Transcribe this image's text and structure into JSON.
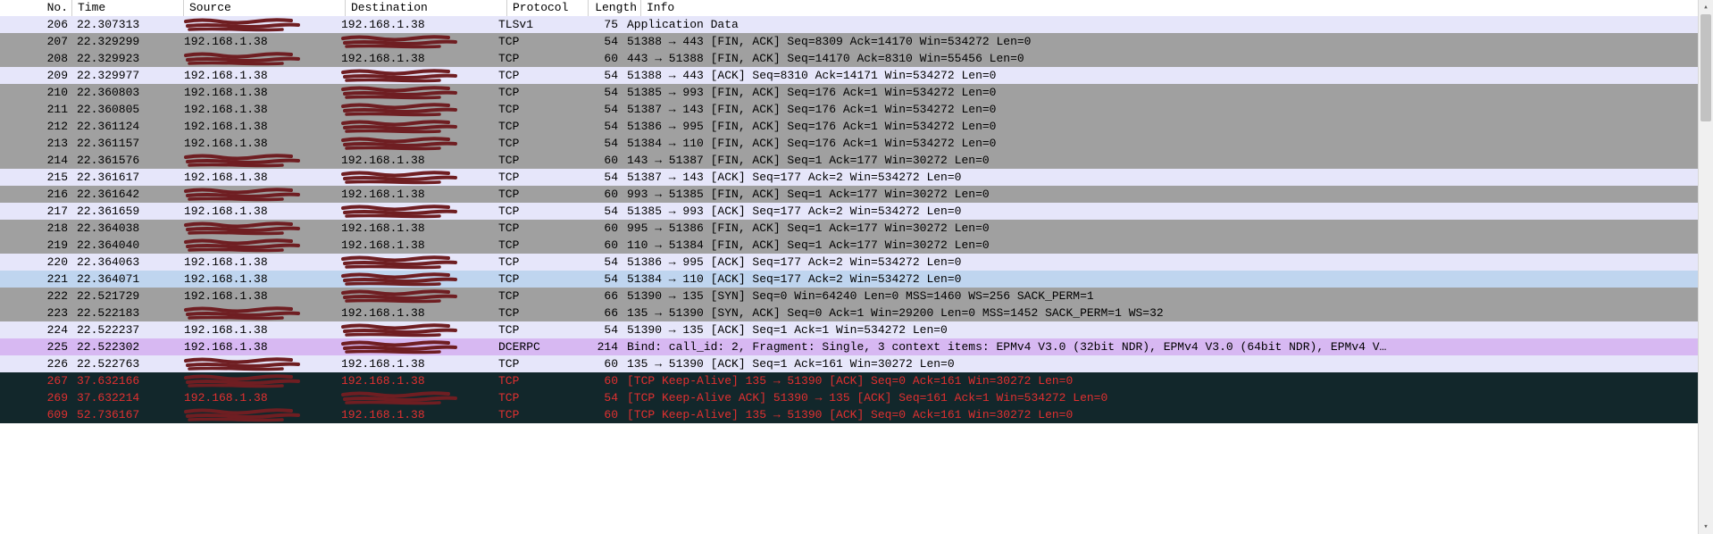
{
  "columns": [
    "No.",
    "Time",
    "Source",
    "Destination",
    "Protocol",
    "Length",
    "Info"
  ],
  "redacted_label": "(redacted)",
  "rows": [
    {
      "no": 206,
      "time": "22.307313",
      "src": "REDACTED",
      "dst": "192.168.1.38",
      "proto": "TLSv1",
      "len": 75,
      "info": "Application Data",
      "theme": "lav"
    },
    {
      "no": 207,
      "time": "22.329299",
      "src": "192.168.1.38",
      "dst": "REDACTED",
      "proto": "TCP",
      "len": 54,
      "info": "51388 → 443 [FIN, ACK] Seq=8309 Ack=14170 Win=534272 Len=0",
      "theme": "gray"
    },
    {
      "no": 208,
      "time": "22.329923",
      "src": "REDACTED",
      "dst": "192.168.1.38",
      "proto": "TCP",
      "len": 60,
      "info": "443 → 51388 [FIN, ACK] Seq=14170 Ack=8310 Win=55456 Len=0",
      "theme": "gray"
    },
    {
      "no": 209,
      "time": "22.329977",
      "src": "192.168.1.38",
      "dst": "REDACTED",
      "proto": "TCP",
      "len": 54,
      "info": "51388 → 443 [ACK] Seq=8310 Ack=14171 Win=534272 Len=0",
      "theme": "lav"
    },
    {
      "no": 210,
      "time": "22.360803",
      "src": "192.168.1.38",
      "dst": "REDACTED",
      "proto": "TCP",
      "len": 54,
      "info": "51385 → 993 [FIN, ACK] Seq=176 Ack=1 Win=534272 Len=0",
      "theme": "gray"
    },
    {
      "no": 211,
      "time": "22.360805",
      "src": "192.168.1.38",
      "dst": "REDACTED",
      "proto": "TCP",
      "len": 54,
      "info": "51387 → 143 [FIN, ACK] Seq=176 Ack=1 Win=534272 Len=0",
      "theme": "gray"
    },
    {
      "no": 212,
      "time": "22.361124",
      "src": "192.168.1.38",
      "dst": "REDACTED",
      "proto": "TCP",
      "len": 54,
      "info": "51386 → 995 [FIN, ACK] Seq=176 Ack=1 Win=534272 Len=0",
      "theme": "gray"
    },
    {
      "no": 213,
      "time": "22.361157",
      "src": "192.168.1.38",
      "dst": "REDACTED",
      "proto": "TCP",
      "len": 54,
      "info": "51384 → 110 [FIN, ACK] Seq=176 Ack=1 Win=534272 Len=0",
      "theme": "gray"
    },
    {
      "no": 214,
      "time": "22.361576",
      "src": "REDACTED",
      "dst": "192.168.1.38",
      "proto": "TCP",
      "len": 60,
      "info": "143 → 51387 [FIN, ACK] Seq=1 Ack=177 Win=30272 Len=0",
      "theme": "gray"
    },
    {
      "no": 215,
      "time": "22.361617",
      "src": "192.168.1.38",
      "dst": "REDACTED",
      "proto": "TCP",
      "len": 54,
      "info": "51387 → 143 [ACK] Seq=177 Ack=2 Win=534272 Len=0",
      "theme": "lav"
    },
    {
      "no": 216,
      "time": "22.361642",
      "src": "REDACTED",
      "dst": "192.168.1.38",
      "proto": "TCP",
      "len": 60,
      "info": "993 → 51385 [FIN, ACK] Seq=1 Ack=177 Win=30272 Len=0",
      "theme": "gray"
    },
    {
      "no": 217,
      "time": "22.361659",
      "src": "192.168.1.38",
      "dst": "REDACTED",
      "proto": "TCP",
      "len": 54,
      "info": "51385 → 993 [ACK] Seq=177 Ack=2 Win=534272 Len=0",
      "theme": "lav"
    },
    {
      "no": 218,
      "time": "22.364038",
      "src": "REDACTED",
      "dst": "192.168.1.38",
      "proto": "TCP",
      "len": 60,
      "info": "995 → 51386 [FIN, ACK] Seq=1 Ack=177 Win=30272 Len=0",
      "theme": "gray"
    },
    {
      "no": 219,
      "time": "22.364040",
      "src": "REDACTED",
      "dst": "192.168.1.38",
      "proto": "TCP",
      "len": 60,
      "info": "110 → 51384 [FIN, ACK] Seq=1 Ack=177 Win=30272 Len=0",
      "theme": "gray"
    },
    {
      "no": 220,
      "time": "22.364063",
      "src": "192.168.1.38",
      "dst": "REDACTED",
      "proto": "TCP",
      "len": 54,
      "info": "51386 → 995 [ACK] Seq=177 Ack=2 Win=534272 Len=0",
      "theme": "lav"
    },
    {
      "no": 221,
      "time": "22.364071",
      "src": "192.168.1.38",
      "dst": "REDACTED",
      "proto": "TCP",
      "len": 54,
      "info": "51384 → 110 [ACK] Seq=177 Ack=2 Win=534272 Len=0",
      "theme": "lblue"
    },
    {
      "no": 222,
      "time": "22.521729",
      "src": "192.168.1.38",
      "dst": "REDACTED",
      "proto": "TCP",
      "len": 66,
      "info": "51390 → 135 [SYN] Seq=0 Win=64240 Len=0 MSS=1460 WS=256 SACK_PERM=1",
      "theme": "gray"
    },
    {
      "no": 223,
      "time": "22.522183",
      "src": "REDACTED",
      "dst": "192.168.1.38",
      "proto": "TCP",
      "len": 66,
      "info": "135 → 51390 [SYN, ACK] Seq=0 Ack=1 Win=29200 Len=0 MSS=1452 SACK_PERM=1 WS=32",
      "theme": "gray"
    },
    {
      "no": 224,
      "time": "22.522237",
      "src": "192.168.1.38",
      "dst": "REDACTED",
      "proto": "TCP",
      "len": 54,
      "info": "51390 → 135 [ACK] Seq=1 Ack=1 Win=534272 Len=0",
      "theme": "lav"
    },
    {
      "no": 225,
      "time": "22.522302",
      "src": "192.168.1.38",
      "dst": "REDACTED",
      "proto": "DCERPC",
      "len": 214,
      "info": "Bind: call_id: 2, Fragment: Single, 3 context items: EPMv4 V3.0 (32bit NDR), EPMv4 V3.0 (64bit NDR), EPMv4 V…",
      "theme": "purp"
    },
    {
      "no": 226,
      "time": "22.522763",
      "src": "REDACTED",
      "dst": "192.168.1.38",
      "proto": "TCP",
      "len": 60,
      "info": "135 → 51390 [ACK] Seq=1 Ack=161 Win=30272 Len=0",
      "theme": "lav"
    },
    {
      "no": 267,
      "time": "37.632166",
      "src": "REDACTED",
      "dst": "192.168.1.38",
      "proto": "TCP",
      "len": 60,
      "info": "[TCP Keep-Alive] 135 → 51390 [ACK] Seq=0 Ack=161 Win=30272 Len=0",
      "theme": "dark"
    },
    {
      "no": 269,
      "time": "37.632214",
      "src": "192.168.1.38",
      "dst": "REDACTED",
      "proto": "TCP",
      "len": 54,
      "info": "[TCP Keep-Alive ACK] 51390 → 135 [ACK] Seq=161 Ack=1 Win=534272 Len=0",
      "theme": "dark"
    },
    {
      "no": 609,
      "time": "52.736167",
      "src": "REDACTED",
      "dst": "192.168.1.38",
      "proto": "TCP",
      "len": 60,
      "info": "[TCP Keep-Alive] 135 → 51390 [ACK] Seq=0 Ack=161 Win=30272 Len=0",
      "theme": "dark"
    }
  ]
}
